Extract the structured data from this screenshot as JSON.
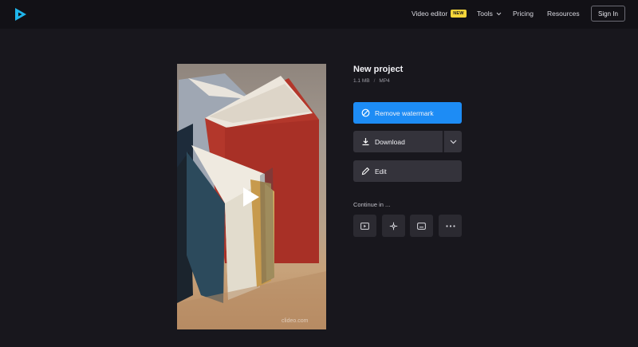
{
  "nav": {
    "video_editor": "Video editor",
    "new_badge": "NEW",
    "tools": "Tools",
    "pricing": "Pricing",
    "resources": "Resources",
    "sign_in": "Sign In"
  },
  "project": {
    "title": "New project",
    "size": "1.1 MB",
    "separator": "/",
    "format": "MP4"
  },
  "actions": {
    "remove_watermark": "Remove watermark",
    "download": "Download",
    "edit": "Edit"
  },
  "continue_in": {
    "label": "Continue in ...",
    "tools": [
      "video-editor-icon",
      "ai-tool-icon",
      "subtitles-icon",
      "more-icon"
    ]
  },
  "preview": {
    "watermark": "clideo.com"
  },
  "colors": {
    "accent": "#1d8cf5",
    "badge": "#f5d53a",
    "background": "#18171d",
    "logo": "#1fb6ec"
  }
}
